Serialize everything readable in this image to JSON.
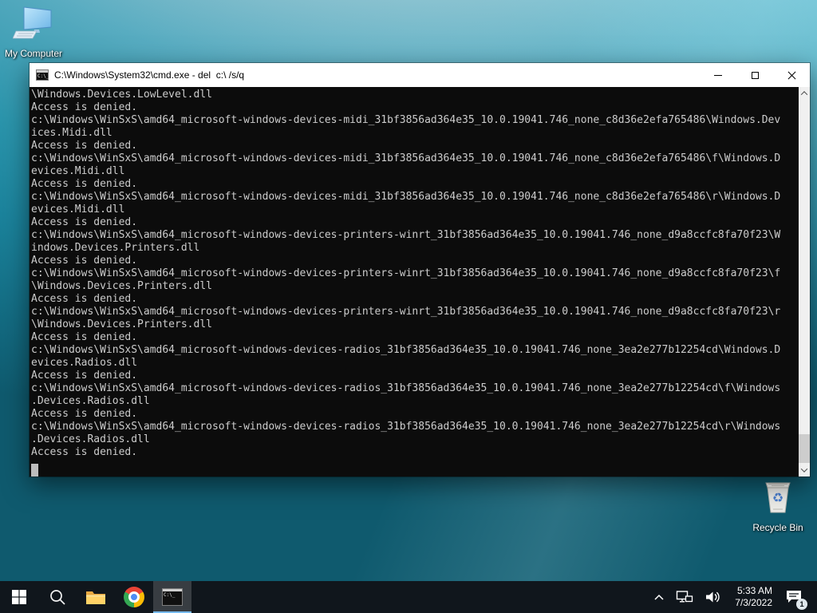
{
  "desktop": {
    "icons": [
      {
        "label": "My Computer"
      },
      {
        "label": "Recycle Bin"
      }
    ]
  },
  "window": {
    "title": "C:\\Windows\\System32\\cmd.exe - del  c:\\ /s/q"
  },
  "console": {
    "background": "#0c0c0c",
    "text_color": "#cccccc",
    "lines": [
      "\\Windows.Devices.LowLevel.dll",
      "Access is denied.",
      "c:\\Windows\\WinSxS\\amd64_microsoft-windows-devices-midi_31bf3856ad364e35_10.0.19041.746_none_c8d36e2efa765486\\Windows.Dev",
      "ices.Midi.dll",
      "Access is denied.",
      "c:\\Windows\\WinSxS\\amd64_microsoft-windows-devices-midi_31bf3856ad364e35_10.0.19041.746_none_c8d36e2efa765486\\f\\Windows.D",
      "evices.Midi.dll",
      "Access is denied.",
      "c:\\Windows\\WinSxS\\amd64_microsoft-windows-devices-midi_31bf3856ad364e35_10.0.19041.746_none_c8d36e2efa765486\\r\\Windows.D",
      "evices.Midi.dll",
      "Access is denied.",
      "c:\\Windows\\WinSxS\\amd64_microsoft-windows-devices-printers-winrt_31bf3856ad364e35_10.0.19041.746_none_d9a8ccfc8fa70f23\\W",
      "indows.Devices.Printers.dll",
      "Access is denied.",
      "c:\\Windows\\WinSxS\\amd64_microsoft-windows-devices-printers-winrt_31bf3856ad364e35_10.0.19041.746_none_d9a8ccfc8fa70f23\\f",
      "\\Windows.Devices.Printers.dll",
      "Access is denied.",
      "c:\\Windows\\WinSxS\\amd64_microsoft-windows-devices-printers-winrt_31bf3856ad364e35_10.0.19041.746_none_d9a8ccfc8fa70f23\\r",
      "\\Windows.Devices.Printers.dll",
      "Access is denied.",
      "c:\\Windows\\WinSxS\\amd64_microsoft-windows-devices-radios_31bf3856ad364e35_10.0.19041.746_none_3ea2e277b12254cd\\Windows.D",
      "evices.Radios.dll",
      "Access is denied.",
      "c:\\Windows\\WinSxS\\amd64_microsoft-windows-devices-radios_31bf3856ad364e35_10.0.19041.746_none_3ea2e277b12254cd\\f\\Windows",
      ".Devices.Radios.dll",
      "Access is denied.",
      "c:\\Windows\\WinSxS\\amd64_microsoft-windows-devices-radios_31bf3856ad364e35_10.0.19041.746_none_3ea2e277b12254cd\\r\\Windows",
      ".Devices.Radios.dll",
      "Access is denied."
    ]
  },
  "taskbar": {
    "tray": {
      "time": "5:33 AM",
      "date": "7/3/2022",
      "notification_count": "1"
    }
  }
}
